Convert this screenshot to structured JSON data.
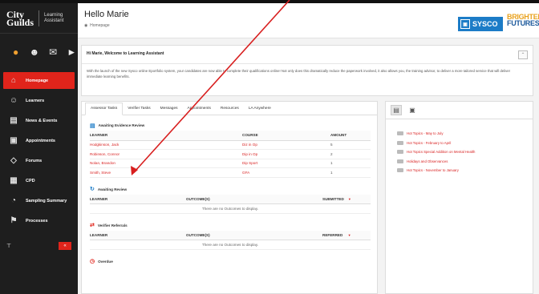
{
  "app": {
    "brand_city": "City",
    "brand_guilds": "Guilds",
    "app_name_line1": "Learning",
    "app_name_line2": "Assistant"
  },
  "sidebar": {
    "items": [
      {
        "label": "Homepage",
        "icon": "home-icon",
        "active": true
      },
      {
        "label": "Learners",
        "icon": "people-icon",
        "active": false
      },
      {
        "label": "News & Events",
        "icon": "news-icon",
        "active": false
      },
      {
        "label": "Appointments",
        "icon": "calendar-icon",
        "active": false
      },
      {
        "label": "Forums",
        "icon": "chat-icon",
        "active": false
      },
      {
        "label": "CPD",
        "icon": "gift-icon",
        "active": false
      },
      {
        "label": "Sampling Summary",
        "icon": "chart-icon",
        "active": false
      },
      {
        "label": "Processes",
        "icon": "flag-icon",
        "active": false
      }
    ],
    "collapse_label": "«"
  },
  "header": {
    "greeting": "Hello Marie",
    "breadcrumb": "Homepage",
    "partner1": "SYSCO",
    "partner2_line1": "BRIGHTER",
    "partner2_line2": "FUTURES"
  },
  "welcome": {
    "title": "Hi Marie, Welcome to Learning Assistant",
    "body": "With the launch of the new Sysco online Eportfolio system, your candidates are now able to complete their qualifications online! Not only does this dramatically reduce the paperwork involved, it also allows you, the training advisor, to deliver a more tailored service that will deliver immediate learning benefits."
  },
  "tabs": [
    "Assessor Tasks",
    "Verifier Tasks",
    "Messages",
    "Appointments",
    "Resources",
    "LA Anywhere"
  ],
  "evidence": {
    "title": "Awaiting Evidence Review",
    "headers": [
      "LEARNER",
      "COURSE",
      "AMOUNT"
    ],
    "rows": [
      {
        "learner": "Hodgkinson, Jack",
        "course": "Diz in Op",
        "amount": "5"
      },
      {
        "learner": "Robinson, Connor",
        "course": "Dip in Op",
        "amount": "2"
      },
      {
        "learner": "Nolan, Brandon",
        "course": "Dip Sport",
        "amount": "1"
      },
      {
        "learner": "Smith, Steve",
        "course": "GFA",
        "amount": "1"
      }
    ]
  },
  "review": {
    "title": "Awaiting Review",
    "headers": [
      "LEARNER",
      "OUTCOME(S)",
      "SUBMITTED"
    ],
    "empty": "There are no Outcomes to display."
  },
  "referrals": {
    "title": "Verifier Referrals",
    "headers": [
      "LEARNER",
      "OUTCOME(S)",
      "REFERRED"
    ],
    "empty": "There are no Outcomes to display."
  },
  "overdue": {
    "title": "Overdue"
  },
  "news": [
    "Hot Topics - May to July",
    "Hot Topics - February to April",
    "Hot Topics Special Addition on Mental Health",
    "Holidays and Observances",
    "Hot Topics - November to January"
  ],
  "colors": {
    "accent": "#e0241b",
    "sidebar": "#1e1e1e",
    "sysco": "#1c7cc7"
  }
}
